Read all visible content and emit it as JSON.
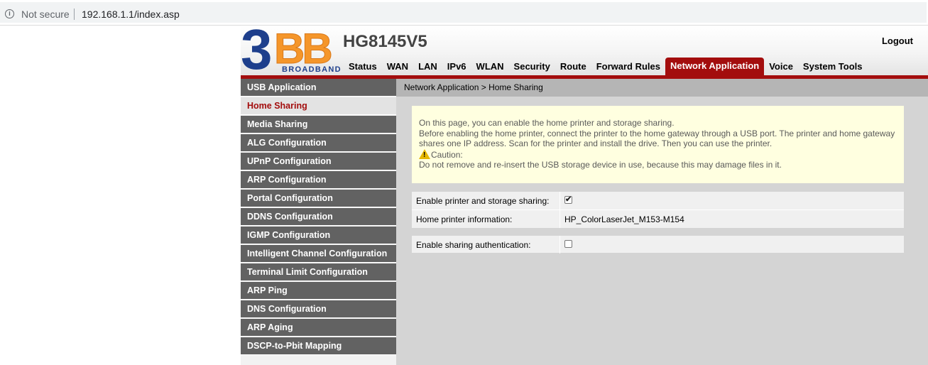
{
  "browser": {
    "security_label": "Not secure",
    "url": "192.168.1.1/index.asp"
  },
  "header": {
    "logo_big": "3",
    "logo_bb": "BB",
    "logo_sub": "BROADBAND",
    "model": "HG8145V5",
    "logout": "Logout"
  },
  "topnav": [
    "Status",
    "WAN",
    "LAN",
    "IPv6",
    "WLAN",
    "Security",
    "Route",
    "Forward Rules",
    "Network Application",
    "Voice",
    "System Tools"
  ],
  "topnav_active": "Network Application",
  "sidebar": {
    "items": [
      {
        "label": "USB Application",
        "active": false
      },
      {
        "label": "Home Sharing",
        "active": true
      },
      {
        "label": "Media Sharing",
        "active": false
      },
      {
        "label": "ALG Configuration",
        "active": false
      },
      {
        "label": "UPnP Configuration",
        "active": false
      },
      {
        "label": "ARP Configuration",
        "active": false
      },
      {
        "label": "Portal Configuration",
        "active": false
      },
      {
        "label": "DDNS Configuration",
        "active": false
      },
      {
        "label": "IGMP Configuration",
        "active": false
      },
      {
        "label": "Intelligent Channel Configuration",
        "active": false
      },
      {
        "label": "Terminal Limit Configuration",
        "active": false
      },
      {
        "label": "ARP Ping",
        "active": false
      },
      {
        "label": "DNS Configuration",
        "active": false
      },
      {
        "label": "ARP Aging",
        "active": false
      },
      {
        "label": "DSCP-to-Pbit Mapping",
        "active": false
      }
    ]
  },
  "breadcrumb": "Network Application > Home Sharing",
  "notice": {
    "line1": "On this page, you can enable the home printer and storage sharing.",
    "line2": "Before enabling the home printer, connect the printer to the home gateway through a USB port. The printer and home gateway shares one IP address. Scan for the printer and install the drive. Then you can use the printer.",
    "caution_label": "Caution:",
    "caution_text": "Do not remove and re-insert the USB storage device in use, because this may damage files in it."
  },
  "form": {
    "enable_sharing_label": "Enable printer and storage sharing:",
    "enable_sharing_checked": true,
    "printer_info_label": "Home printer information:",
    "printer_info_value": "HP_ColorLaserJet_M153-M154",
    "auth_label": "Enable sharing authentication:",
    "auth_checked": false
  },
  "colors": {
    "accent_red": "#a30d0d",
    "sidebar_gray": "#626262",
    "notice_bg": "#ffffe0"
  }
}
